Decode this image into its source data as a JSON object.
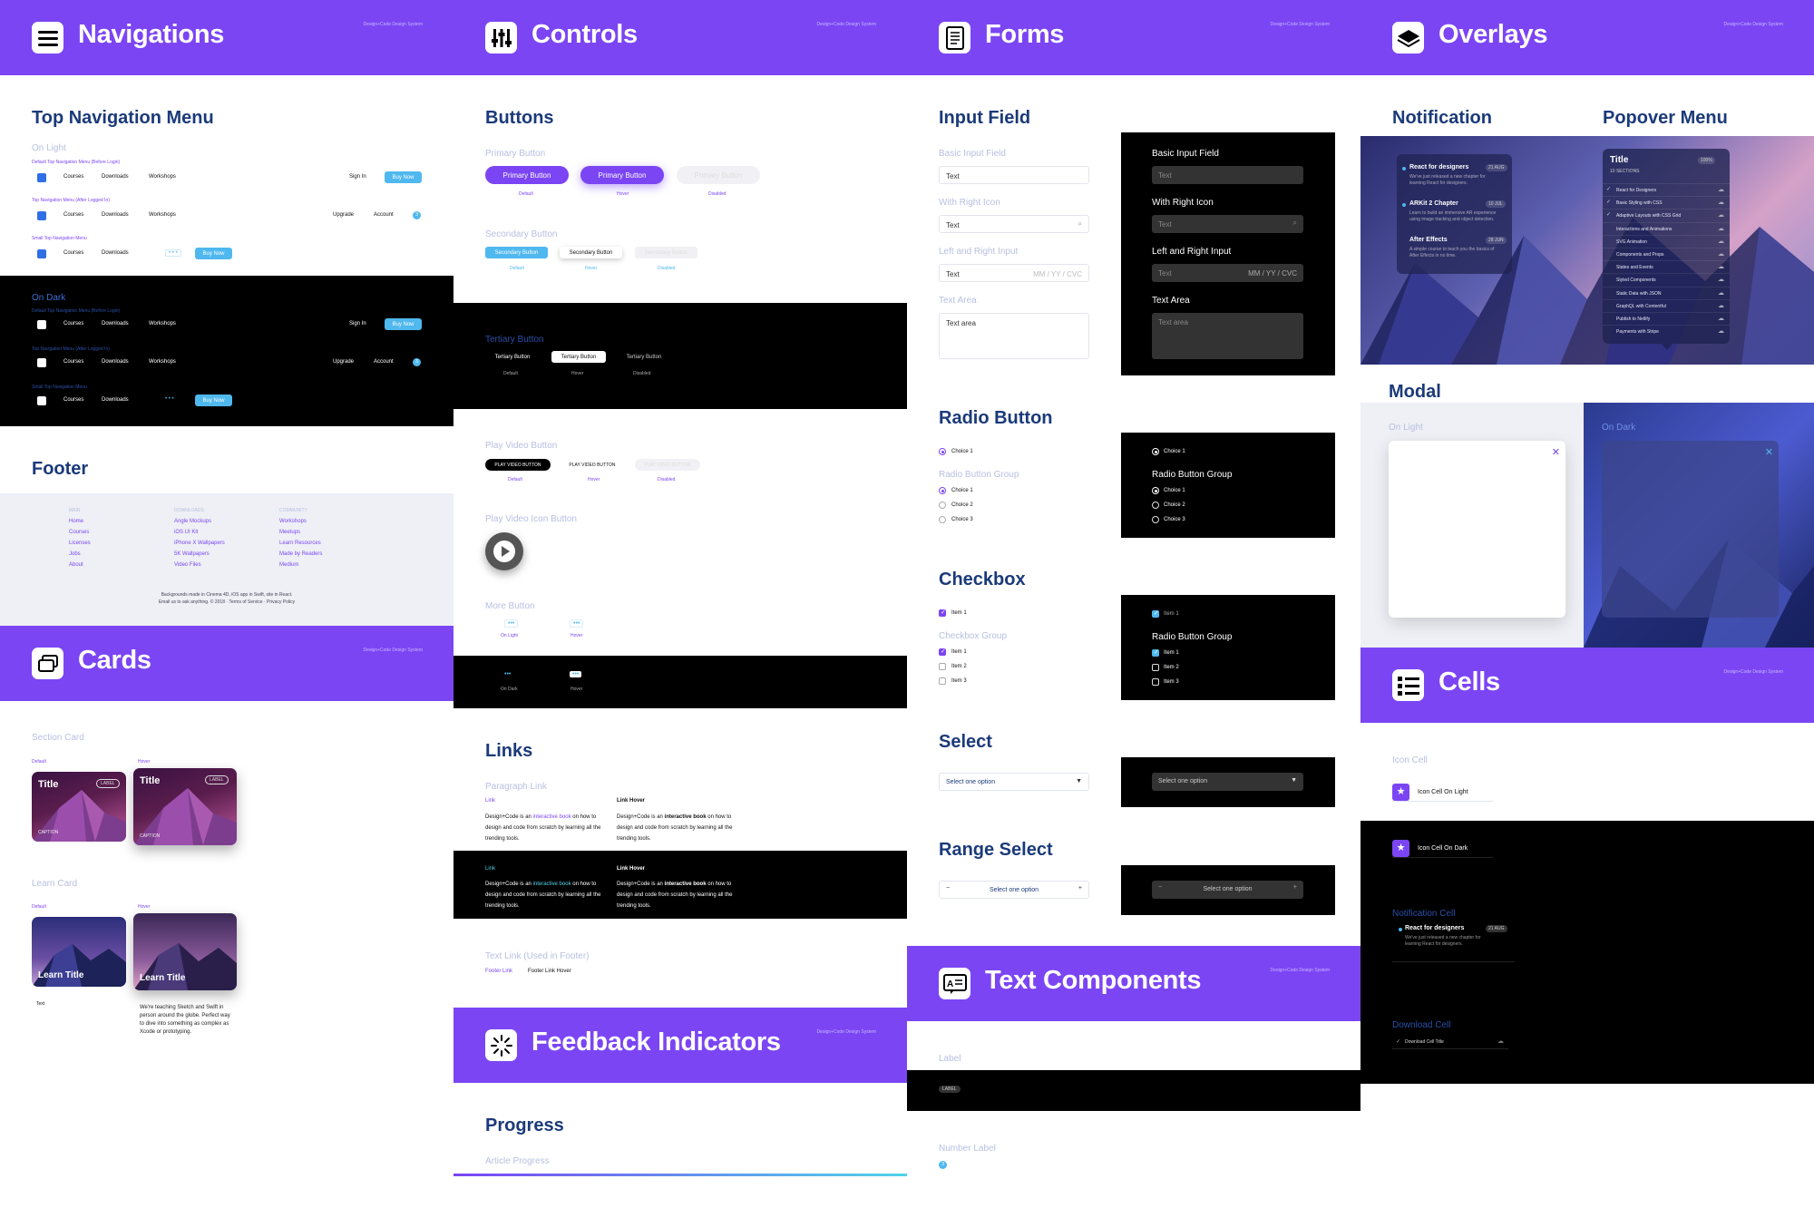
{
  "colors": {
    "accent": "#7b45f4",
    "blue": "#4fb8ef",
    "navy": "#1b3a7a"
  },
  "sections": {
    "navigations": {
      "title": "Navigations",
      "icon": "hamburger-icon",
      "tiny": "Design+Code Design System"
    },
    "controls": {
      "title": "Controls",
      "icon": "sliders-icon",
      "tiny": "Design+Code Design System"
    },
    "forms": {
      "title": "Forms",
      "icon": "document-icon",
      "tiny": "Design+Code Design System"
    },
    "overlays": {
      "title": "Overlays",
      "icon": "layers-icon",
      "tiny": "Design+Code Design System"
    },
    "cards": {
      "title": "Cards",
      "icon": "cards-icon",
      "tiny": "Design+Code Design System"
    },
    "cells": {
      "title": "Cells",
      "icon": "list-icon",
      "tiny": "Design+Code Design System"
    },
    "feedback": {
      "title": "Feedback Indicators",
      "icon": "spinner-icon",
      "tiny": "Design+Code Design System"
    },
    "text_components": {
      "title": "Text Components",
      "icon": "text-icon",
      "tiny": "Design+Code Design System"
    }
  },
  "nav": {
    "heading": "Top Navigation Menu",
    "on_light": "On Light",
    "on_dark": "On Dark",
    "cap1": "Default Top Navigation Menu (Before Login)",
    "cap2": "Top Navigation Menu (After Logged In)",
    "cap3": "Small Top Navigation Menu",
    "courses": "Courses",
    "downloads": "Downloads",
    "workshops": "Workshops",
    "sign_in": "Sign In",
    "buy_now": "Buy Now",
    "upgrade": "Upgrade",
    "account": "Account",
    "badge": "3",
    "more": "• • •"
  },
  "footer": {
    "heading": "Footer",
    "columns": [
      {
        "title": "MAIN",
        "links": [
          "Home",
          "Courses",
          "Licenses",
          "Jobs",
          "About"
        ]
      },
      {
        "title": "DOWNLOADS",
        "links": [
          "Angle Mockups",
          "iOS UI Kit",
          "iPhone X Wallpapers",
          "5K Wallpapers",
          "Video Files"
        ]
      },
      {
        "title": "COMMUNITY",
        "links": [
          "Workshops",
          "Meetups",
          "Learn Resources",
          "Made by Readers",
          "Medium"
        ]
      }
    ],
    "legal1": "Backgrounds made in Cinema 4D, iOS app in Swift, site in React.",
    "legal2": "Email us to ask anything. © 2018 · Terms of Service · Privacy Policy"
  },
  "cards": {
    "section_card": "Section Card",
    "default": "Default",
    "hover": "Hover",
    "title": "Title",
    "label": "LABEL",
    "caption": "CAPTION",
    "learn_card": "Learn Card",
    "learn_title": "Learn Title",
    "text_cap": "Text",
    "desc": "We're teaching Sketch and Swift in person around the globe. Perfect way to dive into something as complex as Xcode or prototyping."
  },
  "controls": {
    "buttons": "Buttons",
    "primary": "Primary Button",
    "primary_label": "Primary Button",
    "secondary": "Secondary Button",
    "secondary_label": "Secondary Button",
    "tertiary": "Tertiary Button",
    "tertiary_label": "Tertiary Button",
    "play_video": "Play Video Button",
    "play_video_label": "PLAY VIDEO BUTTON",
    "play_icon": "Play Video Icon Button",
    "more": "More Button",
    "on_light": "On Light",
    "on_dark": "On Dark",
    "default": "Default",
    "hover": "Hover",
    "disabled": "Disabled",
    "links": "Links",
    "paragraph_link": "Paragraph Link",
    "link": "Link",
    "link_hover": "Link Hover",
    "para1": "Design+Code is an ",
    "para_link": "interactive book",
    "para2": " on how to design and code from scratch by learning all the trending tools.",
    "text_link": "Text Link (Used in Footer)",
    "footer_link": "Footer Link",
    "footer_link_hover": "Footer Link Hover",
    "progress": "Progress",
    "article_progress": "Article Progress"
  },
  "forms": {
    "input_field": "Input Field",
    "basic": "Basic Input Field",
    "with_right_icon": "With Right Icon",
    "left_right": "Left and Right Input",
    "text_area": "Text Area",
    "text": "Text",
    "text_area_ph": "Text area",
    "date_ph": "MM / YY / CVC",
    "radio_button": "Radio Button",
    "radio_group": "Radio Button Group",
    "choices": [
      "Choice 1",
      "Choice 1",
      "Choice 2",
      "Choice 3"
    ],
    "checkbox": "Checkbox",
    "checkbox_group": "Checkbox Group",
    "items": [
      "Item 1",
      "Item 1",
      "Item 2",
      "Item 3"
    ],
    "select": "Select",
    "select_ph": "Select one option",
    "range_select": "Range Select",
    "minus": "−",
    "plus": "+"
  },
  "text_components": {
    "label": "Label",
    "label_tag": "LABEL",
    "number_label": "Number Label",
    "number": "3"
  },
  "overlays": {
    "notification": "Notification",
    "popover": "Popover Menu",
    "notes": [
      {
        "title": "React for designers",
        "date": "21 AUG",
        "body": "We've just released a new chapter for learning React for designers."
      },
      {
        "title": "ARKit 2 Chapter",
        "date": "10 JUL",
        "body": "Learn to build an immersive AR experience using image tracking and object detection."
      },
      {
        "title": "After Effects",
        "date": "28 JUN",
        "body": "A simple course to teach you the basics of After Effects in no time."
      }
    ],
    "pop_title": "Title",
    "pop_pct": "100%",
    "pop_sub": "10 SECTIONS",
    "pop_items": [
      "React for Designers",
      "Basic Styling with CSS",
      "Adaptive Layouts with CSS Grid",
      "Interactions and Animations",
      "SVG Animation",
      "Components and Props",
      "States and Events",
      "Styled Components",
      "Static Data with JSON",
      "GraphQL with Contentful",
      "Publish to Netlify",
      "Payments with Stripe"
    ],
    "modal": "Modal",
    "on_light": "On Light",
    "on_dark": "On Dark",
    "close": "✕"
  },
  "cells": {
    "icon_cell": "Icon Cell",
    "on_light": "Icon Cell On Light",
    "on_dark": "Icon Cell On Dark",
    "notification_cell": "Notification Cell",
    "note_title": "React for designers",
    "note_date": "21 AUG",
    "note_body": "We've just released a new chapter for learning React for designers.",
    "download_cell": "Download Cell",
    "download_title": "Download Cell Title"
  }
}
